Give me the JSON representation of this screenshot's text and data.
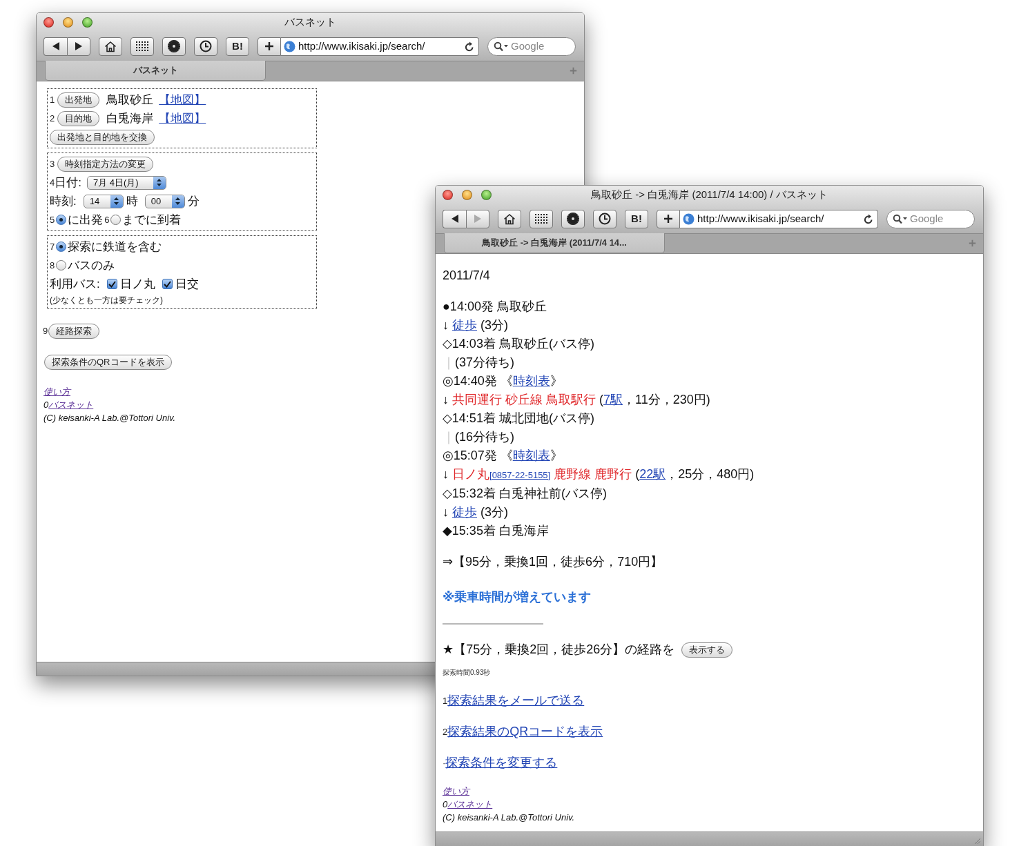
{
  "back_window": {
    "title": "バスネット",
    "toolbar": {
      "forward_disabled": false,
      "bookmark_label": "B!",
      "url": "http://www.ikisaki.jp/search/",
      "search_placeholder": "Google"
    },
    "tab_label": "バスネット",
    "page": {
      "places": [
        {
          "number": "1",
          "button": "出発地",
          "name": "鳥取砂丘",
          "map_link": "【地図】"
        },
        {
          "number": "2",
          "button": "目的地",
          "name": "白兎海岸",
          "map_link": "【地図】"
        }
      ],
      "swap_button": "出発地と目的地を交換",
      "time_mode": {
        "number": "3",
        "button": "時刻指定方法の変更"
      },
      "date": {
        "number": "4",
        "label": "日付:",
        "value": "7月 4日(月)"
      },
      "time": {
        "label": "時刻:",
        "hour": "14",
        "hour_unit": "時",
        "minute": "00",
        "minute_unit": "分"
      },
      "time_options": [
        {
          "number": "5",
          "label": "に出発",
          "selected": true
        },
        {
          "number": "6",
          "label": "までに到着",
          "selected": false
        }
      ],
      "mode_options": [
        {
          "number": "7",
          "label": "探索に鉄道を含む",
          "selected": true
        },
        {
          "number": "8",
          "label": "バスのみ",
          "selected": false
        }
      ],
      "bus": {
        "label": "利用バス:",
        "companies": [
          {
            "label": "日ノ丸",
            "checked": true
          },
          {
            "label": "日交",
            "checked": true
          }
        ],
        "note": "(少なくとも一方は要チェック)"
      },
      "search": {
        "number": "9",
        "button": "経路探索"
      },
      "qr_button": "探索条件のQRコードを表示",
      "footer": {
        "help_link": "使い方",
        "home_prefix": "0",
        "home_link": "バスネット",
        "copyright": "(C) keisanki-A Lab.@Tottori Univ."
      }
    }
  },
  "front_window": {
    "title": "鳥取砂丘 -> 白兎海岸 (2011/7/4 14:00) / バスネット",
    "toolbar": {
      "forward_disabled": true,
      "bookmark_label": "B!",
      "url": "http://www.ikisaki.jp/search/",
      "search_placeholder": "Google"
    },
    "tab_label": "鳥取砂丘 -> 白兎海岸 (2011/7/4 14...",
    "page": {
      "date": "2011/7/4",
      "steps": [
        {
          "parts": [
            {
              "text": "●14:00発 鳥取砂丘",
              "kind": "plain"
            }
          ]
        },
        {
          "parts": [
            {
              "text": "↓ ",
              "kind": "plain"
            },
            {
              "text": "徒歩",
              "kind": "link"
            },
            {
              "text": " (3分)",
              "kind": "plain"
            }
          ]
        },
        {
          "parts": [
            {
              "text": "◇14:03着 鳥取砂丘(バス停)",
              "kind": "plain"
            }
          ]
        },
        {
          "parts": [
            {
              "text": "｜",
              "kind": "faint"
            },
            {
              "text": "(37分待ち)",
              "kind": "plain"
            }
          ]
        },
        {
          "parts": [
            {
              "text": "◎14:40発 《",
              "kind": "plain"
            },
            {
              "text": "時刻表",
              "kind": "link"
            },
            {
              "text": "》",
              "kind": "plain"
            }
          ]
        },
        {
          "parts": [
            {
              "text": "↓ ",
              "kind": "plain"
            },
            {
              "text": "共同運行 砂丘線 鳥取駅行",
              "kind": "route"
            },
            {
              "text": " (",
              "kind": "plain"
            },
            {
              "text": "7駅",
              "kind": "link"
            },
            {
              "text": "，11分，230円)",
              "kind": "plain"
            }
          ]
        },
        {
          "parts": [
            {
              "text": "◇14:51着 城北団地(バス停)",
              "kind": "plain"
            }
          ]
        },
        {
          "parts": [
            {
              "text": "｜",
              "kind": "faint"
            },
            {
              "text": "(16分待ち)",
              "kind": "plain"
            }
          ]
        },
        {
          "parts": [
            {
              "text": "◎15:07発 《",
              "kind": "plain"
            },
            {
              "text": "時刻表",
              "kind": "link"
            },
            {
              "text": "》",
              "kind": "plain"
            }
          ]
        },
        {
          "parts": [
            {
              "text": "↓ ",
              "kind": "plain"
            },
            {
              "text": "日ノ丸",
              "kind": "route"
            },
            {
              "text": "[0857-22-5155]",
              "kind": "phone"
            },
            {
              "text": " 鹿野線 鹿野行",
              "kind": "route"
            },
            {
              "text": " (",
              "kind": "plain"
            },
            {
              "text": "22駅",
              "kind": "link"
            },
            {
              "text": "，25分，480円)",
              "kind": "plain"
            }
          ]
        },
        {
          "parts": [
            {
              "text": "◇15:32着 白兎神社前(バス停)",
              "kind": "plain"
            }
          ]
        },
        {
          "parts": [
            {
              "text": "↓ ",
              "kind": "plain"
            },
            {
              "text": "徒歩",
              "kind": "link"
            },
            {
              "text": " (3分)",
              "kind": "plain"
            }
          ]
        },
        {
          "parts": [
            {
              "text": "◆15:35着 白兎海岸",
              "kind": "plain"
            }
          ]
        }
      ],
      "summary": "⇒【95分，乗換1回，徒歩6分，710円】",
      "notice": "※乗車時間が増えています",
      "alternative": {
        "text": "★【75分，乗換2回，徒歩26分】の経路を",
        "button": "表示する"
      },
      "search_time": "探索時間0.93秒",
      "actions": [
        {
          "number": "1",
          "label": "探索結果をメールで送る"
        },
        {
          "number": "2",
          "label": "探索結果のQRコードを表示"
        },
        {
          "number": "·",
          "label": "探索条件を変更する"
        }
      ],
      "footer": {
        "help_link": "使い方",
        "home_prefix": "0",
        "home_link": "バスネット",
        "copyright": "(C) keisanki-A Lab.@Tottori Univ."
      }
    }
  }
}
